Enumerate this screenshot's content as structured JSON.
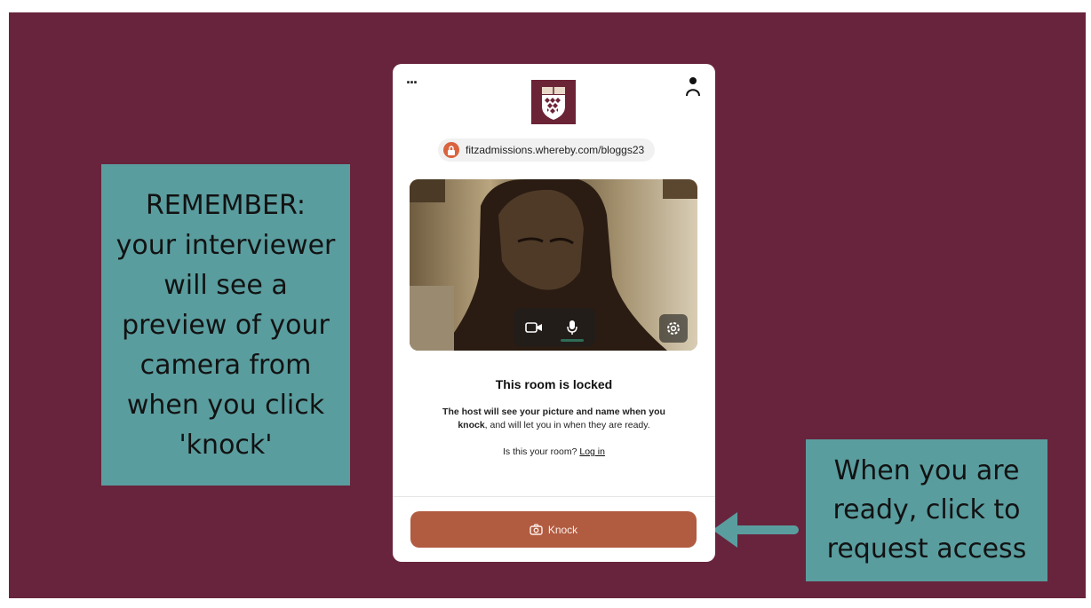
{
  "slide": {
    "left_note": "REMEMBER:\nyour interviewer\nwill see a\npreview of your\ncamera from\nwhen you click\n'knock'",
    "right_note": "When you are\nready, click to\nrequest access"
  },
  "colors": {
    "background": "#68243c",
    "note": "#5a9d9f",
    "knock_button": "#b15b40",
    "lock_badge": "#d9633f"
  },
  "card": {
    "menu_label": "...",
    "room_url": "fitzadmissions.whereby.com/bloggs23",
    "icons": [
      "more-dots-icon",
      "person-icon",
      "lock-icon",
      "camera-icon",
      "microphone-icon",
      "settings-gear-icon",
      "knock-camera-icon"
    ],
    "room_title": "This room is locked",
    "desc_bold_1": "The host will see your picture and name when you",
    "desc_bold_2": "knock",
    "desc_rest": ", and will let you in when they are ready.",
    "question": "Is this your room?",
    "login_link": "Log in",
    "knock_label": "Knock"
  }
}
